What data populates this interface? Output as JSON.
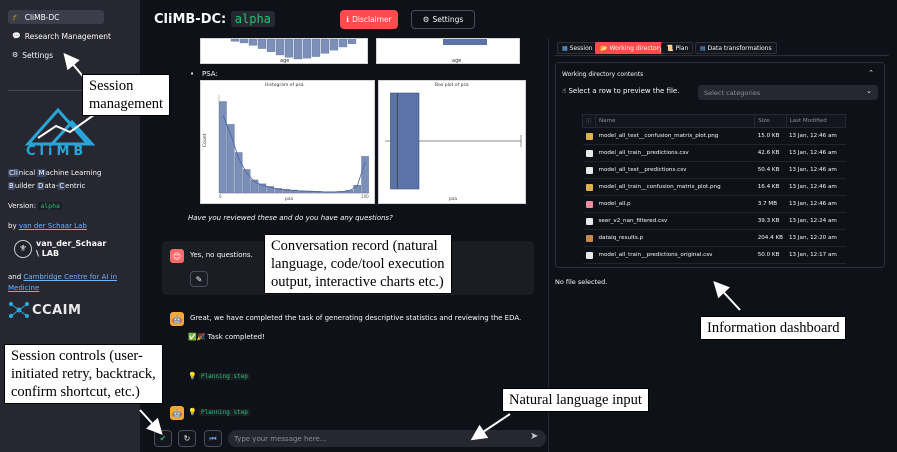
{
  "sidebar": {
    "items": [
      {
        "label": "CliMB-DC",
        "icon": "climb-icon"
      },
      {
        "label": "Research Management",
        "icon": "speech-bubble-icon"
      },
      {
        "label": "Settings",
        "icon": "gear-icon"
      }
    ],
    "logo_word": "CliMB",
    "acronym_line1": [
      "Cli",
      "nical ",
      "M",
      "achine Learning"
    ],
    "acronym_line2": [
      "B",
      "uilder ",
      "D",
      "ata-",
      "C",
      "entric"
    ],
    "version_label": "Version:",
    "version_value": "alpha",
    "by_label": "by",
    "by_link": "van der Schaar Lab",
    "lab_name_line1": "van_der_Schaar",
    "lab_name_line2": "\\ LAB",
    "and_label": "and",
    "and_link": "Cambridge Centre for AI in Medicine",
    "ccaim_word": "CCAIM"
  },
  "header": {
    "title": "CliMB-DC:",
    "title_code": "alpha",
    "disclaimer_label": "Disclaimer",
    "settings_label": "Settings"
  },
  "chat": {
    "top_axis_label_left": "age",
    "top_axis_label_right": "age",
    "psa_label": "PSA:",
    "hist_title": "Histogram of psa",
    "box_title": "Box plot of psa",
    "hist_xlabel": "psa",
    "hist_ylabel": "Count",
    "box_xlabel": "psa",
    "review_question": "Have you reviewed these and do you have any questions?",
    "user_reply": "Yes, no questions.",
    "bot_message": "Great, we have completed the task of generating descriptive statistics and reviewing the EDA.",
    "task_completed": "✅🎉 Task completed!",
    "planning_step_1": "Planning step",
    "planning_step_2": "Planning step",
    "input_placeholder": "Type your message here..."
  },
  "dashboard": {
    "tabs": [
      "Session",
      "Working directory",
      "Plan",
      "Data transformations"
    ],
    "active_tab": "Working directory",
    "expander_title": "Working directory contents",
    "row_hint": "☝ Select a row to preview the file.",
    "select_placeholder": "Select categories",
    "table_headers": [
      "",
      "Name",
      "Size",
      "Last Modified"
    ],
    "files": [
      {
        "type": "image",
        "name": "model_all_test__confusion_matrix_plot.png",
        "size": "15.0 KB",
        "modified": "13 Jan, 12:46 am"
      },
      {
        "type": "doc",
        "name": "model_all_train__predictions.csv",
        "size": "42.6 KB",
        "modified": "13 Jan, 12:46 am"
      },
      {
        "type": "doc",
        "name": "model_all_test__predictions.csv",
        "size": "50.4 KB",
        "modified": "13 Jan, 12:46 am"
      },
      {
        "type": "image",
        "name": "model_all_train__confusion_matrix_plot.png",
        "size": "16.4 KB",
        "modified": "13 Jan, 12:46 am"
      },
      {
        "type": "brain",
        "name": "model_all.p",
        "size": "3.7 MB",
        "modified": "13 Jan, 12:46 am"
      },
      {
        "type": "doc",
        "name": "seer_v2_nan_filtered.csv",
        "size": "39.3 KB",
        "modified": "13 Jan, 12:24 am"
      },
      {
        "type": "package",
        "name": "dataiq_results.p",
        "size": "204.4 KB",
        "modified": "13 Jan, 12:20 am"
      },
      {
        "type": "doc",
        "name": "model_all_train__predictions_original.csv",
        "size": "50.0 KB",
        "modified": "13 Jan, 12:17 am"
      }
    ],
    "no_file": "No file selected."
  },
  "annotations": {
    "session_management": [
      "Session",
      "management"
    ],
    "conversation_record": [
      "Conversation record (natural",
      "language, code/tool execution",
      "output, interactive charts etc.)"
    ],
    "information_dashboard": "Information dashboard",
    "session_controls": [
      "Session controls (user-",
      "initiated retry, backtrack,",
      "confirm shortcut, etc.)"
    ],
    "natural_language_input": "Natural language input"
  },
  "colors": {
    "background": "#0e1117",
    "sidebar": "#262730",
    "accent_red": "#ff4b4b",
    "code_green": "#25c26e",
    "link_blue": "#6fb3ff",
    "chart_bar": "#7b8fb8"
  },
  "chart_data": [
    {
      "type": "bar",
      "title": "Histogram of psa",
      "xlabel": "psa",
      "ylabel": "Count",
      "categories": [
        "0",
        "",
        "",
        "",
        "",
        "",
        "",
        "",
        "",
        "",
        "",
        "",
        "",
        "",
        "",
        "",
        "",
        "",
        "100"
      ],
      "values": [
        1400,
        1050,
        620,
        360,
        200,
        140,
        100,
        70,
        55,
        45,
        35,
        30,
        25,
        20,
        20,
        25,
        40,
        120,
        560
      ],
      "ylim": [
        0,
        1500
      ]
    },
    {
      "type": "bar",
      "title": "Box plot of psa",
      "xlabel": "psa",
      "box": {
        "q1": 4,
        "q3": 25,
        "median": 9,
        "whisker_low": 0,
        "whisker_high": 100
      }
    }
  ]
}
